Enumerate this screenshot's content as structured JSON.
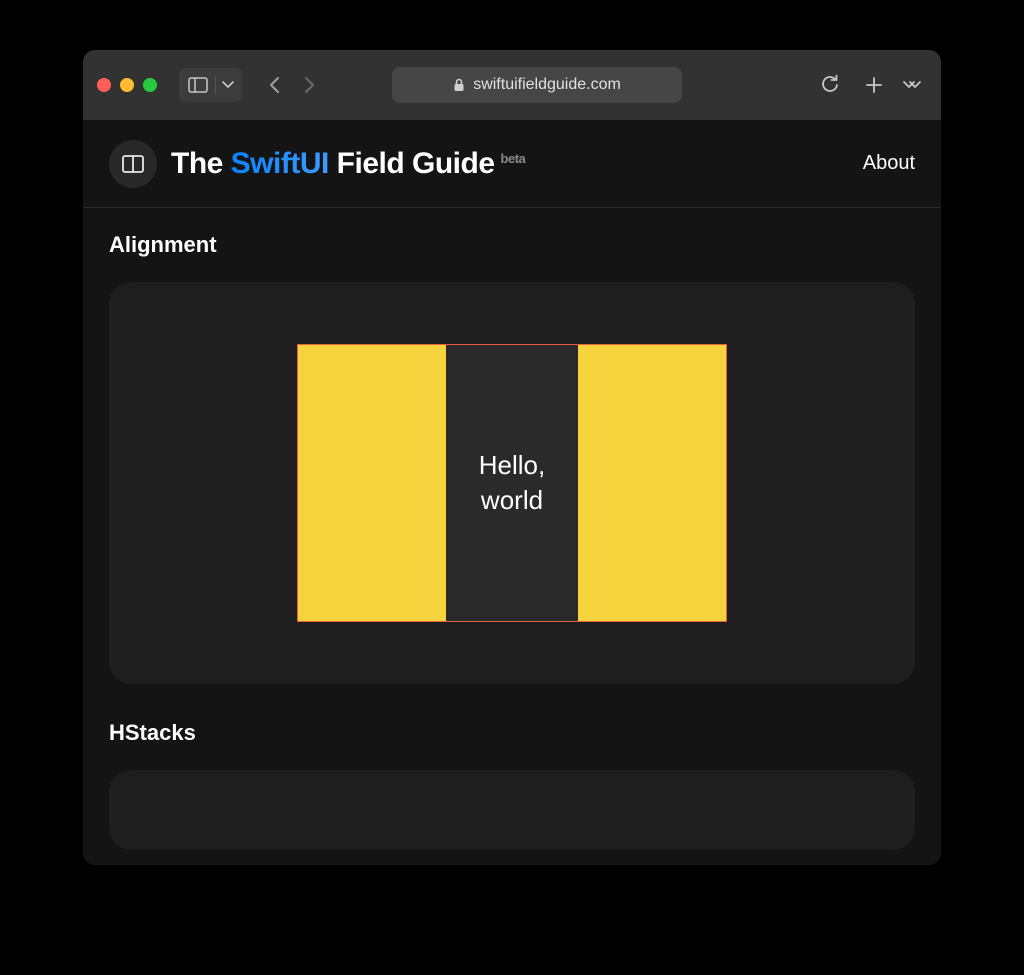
{
  "browser": {
    "url_display": "swiftuifieldguide.com"
  },
  "site": {
    "title_pre": "The ",
    "title_accent": "SwiftUI",
    "title_post": " Field Guide",
    "badge": "beta",
    "nav": {
      "about": "About"
    }
  },
  "sections": [
    {
      "title": "Alignment"
    },
    {
      "title": "HStacks"
    }
  ],
  "demo": {
    "text": "Hello,\nworld",
    "colors": {
      "bar": "#f5d33d",
      "border": "#e8603c",
      "bg": "#2a2a2a"
    }
  }
}
